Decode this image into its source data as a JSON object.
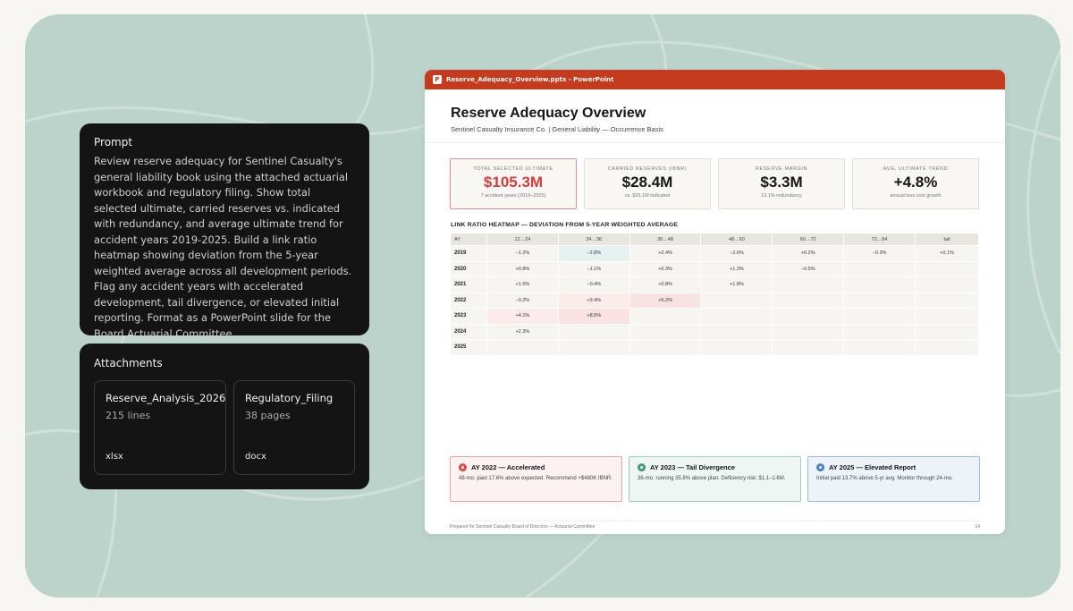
{
  "prompt": {
    "title": "Prompt",
    "text": "Review reserve adequacy for Sentinel Casualty's general liability book using the attached actuarial workbook and regulatory filing. Show total selected ultimate, carried reserves vs. indicated with redundancy, and average ultimate trend for accident years 2019-2025. Build a link ratio heatmap showing deviation from the 5-year weighted average across all development periods. Flag any accident years with accelerated development, tail divergence, or elevated initial reporting. Format as a PowerPoint slide for the Board Actuarial Committee."
  },
  "attachments": {
    "title": "Attachments",
    "files": [
      {
        "name": "Reserve_Analysis_2026",
        "lines": "215 lines",
        "type": "xlsx"
      },
      {
        "name": "Regulatory_Filing",
        "lines": "38 pages",
        "type": "docx"
      }
    ]
  },
  "slide": {
    "window_title": "Reserve_Adequacy_Overview.pptx - PowerPoint",
    "app_icon": "P",
    "title": "Reserve Adequacy Overview",
    "subtitle": "Sentinel Casualty Insurance Co.  |  General Liability — Occurrence Basis",
    "kpis": [
      {
        "label": "TOTAL SELECTED ULTIMATE",
        "value": "$105.3M",
        "note": "7 accident years (2019–2025)"
      },
      {
        "label": "CARRIED RESERVES (IBNR)",
        "value": "$28.4M",
        "note": "vs. $25.1M indicated"
      },
      {
        "label": "RESERVE MARGIN",
        "value": "$3.3M",
        "note": "13.1% redundancy"
      },
      {
        "label": "AVG. ULTIMATE TREND",
        "value": "+4.8%",
        "note": "annual loss cost growth"
      }
    ],
    "heatmap": {
      "title": "LINK RATIO HEATMAP — DEVIATION FROM 5-YEAR WEIGHTED AVERAGE",
      "corner": "AY",
      "columns": [
        "12→24",
        "24→36",
        "36→48",
        "48→60",
        "60→72",
        "72→84",
        "tail"
      ],
      "rows": [
        {
          "year": "2019",
          "cells": [
            "−1.2%",
            "−2.8%",
            "+2.4%",
            "−2.6%",
            "+0.2%",
            "−0.3%",
            "+0.1%"
          ]
        },
        {
          "year": "2020",
          "cells": [
            "+0.8%",
            "−1.1%",
            "+0.3%",
            "+1.2%",
            "−0.5%",
            "",
            ""
          ]
        },
        {
          "year": "2021",
          "cells": [
            "+1.5%",
            "−0.4%",
            "+0.8%",
            "+1.8%",
            "",
            "",
            ""
          ]
        },
        {
          "year": "2022",
          "cells": [
            "−0.2%",
            "+3.4%",
            "+5.2%",
            "",
            "",
            "",
            ""
          ]
        },
        {
          "year": "2023",
          "cells": [
            "+4.1%",
            "+8.5%",
            "",
            "",
            "",
            "",
            ""
          ]
        },
        {
          "year": "2024",
          "cells": [
            "+2.3%",
            "",
            "",
            "",
            "",
            "",
            ""
          ]
        },
        {
          "year": "2025",
          "cells": [
            "",
            "",
            "",
            "",
            "",
            "",
            ""
          ]
        }
      ]
    },
    "flags": [
      {
        "title": "AY 2022 — Accelerated",
        "text": "48-mo. paid 17.6% above expected. Recommend +$480K IBNR."
      },
      {
        "title": "AY 2023 — Tail Divergence",
        "text": "36-mo. running 35.8% above plan. Deficiency risk: $1.1–1.6M."
      },
      {
        "title": "AY 2025 — Elevated Report",
        "text": "Initial paid 13.7% above 5-yr avg. Monitor through 24-mo."
      }
    ],
    "footer_left": "Prepared for Sentinel Casualty Board of Directors — Actuarial Committee",
    "page_number": "14"
  },
  "colors": {
    "background": "#bcd3cc",
    "accent_red": "#c43b1d",
    "highlight_value": "#d23c3c"
  }
}
